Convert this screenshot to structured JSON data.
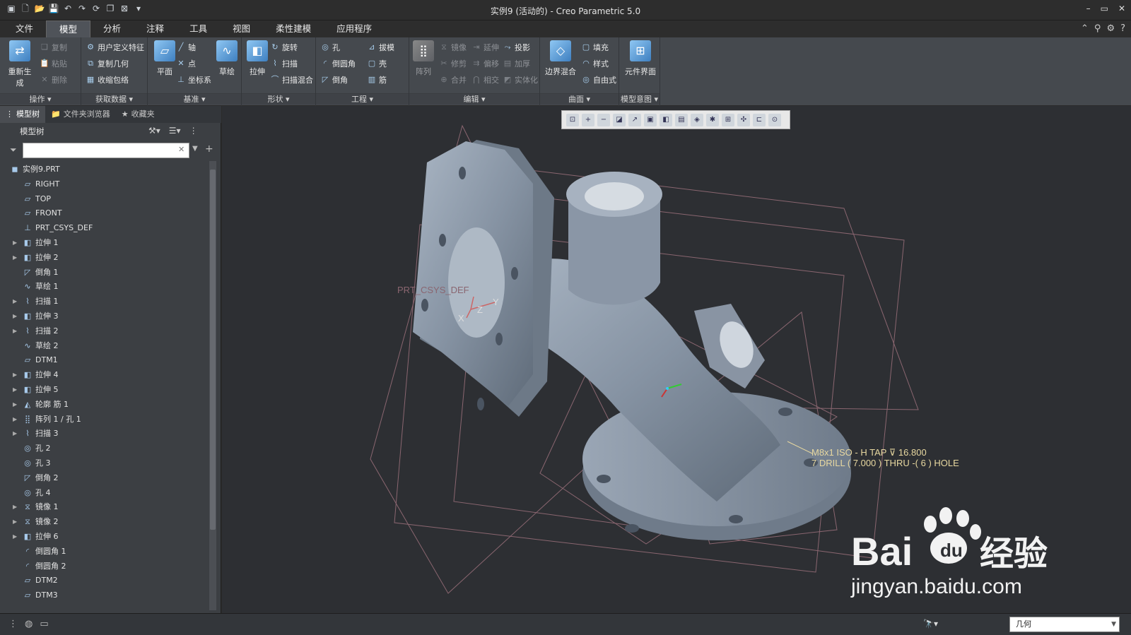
{
  "window": {
    "title": "实例9 (活动的) - Creo Parametric 5.0"
  },
  "tabs": [
    {
      "label": "文件"
    },
    {
      "label": "模型",
      "active": true
    },
    {
      "label": "分析"
    },
    {
      "label": "注释"
    },
    {
      "label": "工具"
    },
    {
      "label": "视图"
    },
    {
      "label": "柔性建模"
    },
    {
      "label": "应用程序"
    }
  ],
  "ribbon": {
    "groups": {
      "operation": "操作",
      "get_data": "获取数据",
      "datum": "基准",
      "shape": "形状",
      "engineering": "工程",
      "edit": "编辑",
      "surface": "曲面",
      "model_intent": "模型意图"
    },
    "buttons": {
      "regenerate": "重新生成",
      "copy": "复制",
      "paste": "粘贴",
      "delete": "删除",
      "udf": "用户定义特征",
      "copy_geom": "复制几何",
      "shrinkwrap": "收缩包络",
      "plane": "平面",
      "axis": "轴",
      "point": "点",
      "csys": "坐标系",
      "sketch": "草绘",
      "extrude": "拉伸",
      "revolve": "旋转",
      "sweep": "扫描",
      "swept_blend": "扫描混合",
      "hole": "孔",
      "round": "倒圆角",
      "chamfer": "倒角",
      "draft": "拔模",
      "shell": "壳",
      "rib": "筋",
      "pattern": "阵列",
      "mirror": "镜像",
      "extend": "延伸",
      "project": "投影",
      "trim": "修剪",
      "offset": "偏移",
      "thicken": "加厚",
      "merge": "合并",
      "intersect": "相交",
      "solidify": "实体化",
      "boundary_blend": "边界混合",
      "fill": "填充",
      "style": "样式",
      "freestyle": "自由式",
      "component_interface": "元件界面"
    }
  },
  "panel": {
    "tabs": [
      {
        "label": "模型树"
      },
      {
        "label": "文件夹浏览器"
      },
      {
        "label": "收藏夹"
      }
    ],
    "title": "模型树",
    "filter_placeholder": "",
    "tree": [
      {
        "label": "实例9.PRT",
        "icon": "part",
        "root": true
      },
      {
        "label": "RIGHT",
        "icon": "plane"
      },
      {
        "label": "TOP",
        "icon": "plane"
      },
      {
        "label": "FRONT",
        "icon": "plane"
      },
      {
        "label": "PRT_CSYS_DEF",
        "icon": "csys"
      },
      {
        "label": "拉伸 1",
        "icon": "extrude",
        "expand": true
      },
      {
        "label": "拉伸 2",
        "icon": "extrude",
        "expand": true
      },
      {
        "label": "倒角 1",
        "icon": "chamfer"
      },
      {
        "label": "草绘 1",
        "icon": "sketch"
      },
      {
        "label": "扫描 1",
        "icon": "sweep",
        "expand": true
      },
      {
        "label": "拉伸 3",
        "icon": "extrude",
        "expand": true
      },
      {
        "label": "扫描 2",
        "icon": "sweep",
        "expand": true
      },
      {
        "label": "草绘 2",
        "icon": "sketch"
      },
      {
        "label": "DTM1",
        "icon": "plane"
      },
      {
        "label": "拉伸 4",
        "icon": "extrude",
        "expand": true
      },
      {
        "label": "拉伸 5",
        "icon": "extrude",
        "expand": true
      },
      {
        "label": "轮廓 筋 1",
        "icon": "rib",
        "expand": true
      },
      {
        "label": "阵列 1 / 孔 1",
        "icon": "pattern",
        "expand": true
      },
      {
        "label": "扫描 3",
        "icon": "sweep",
        "expand": true
      },
      {
        "label": "孔 2",
        "icon": "hole"
      },
      {
        "label": "孔 3",
        "icon": "hole"
      },
      {
        "label": "倒角 2",
        "icon": "chamfer"
      },
      {
        "label": "孔 4",
        "icon": "hole"
      },
      {
        "label": "镜像 1",
        "icon": "mirror",
        "expand": true
      },
      {
        "label": "镜像 2",
        "icon": "mirror",
        "expand": true
      },
      {
        "label": "拉伸 6",
        "icon": "extrude",
        "expand": true
      },
      {
        "label": "倒圆角 1",
        "icon": "round"
      },
      {
        "label": "倒圆角 2",
        "icon": "round"
      },
      {
        "label": "DTM2",
        "icon": "plane"
      },
      {
        "label": "DTM3",
        "icon": "plane"
      }
    ]
  },
  "viewport": {
    "csys_label": "PRT_CSYS_DEF",
    "axis_x": "X",
    "axis_y": "Y",
    "axis_z": "Z",
    "annotation_line1": "M8x1 ISO - H TAP ⊽ 16.800",
    "annotation_line2": "7 DRILL ( 7.000 ) THRU -( 6 ) HOLE",
    "watermark_main": "Bai",
    "watermark_cn": "经验",
    "watermark_url": "jingyan.baidu.com"
  },
  "status": {
    "selection_filter": "几何"
  },
  "colors": {
    "background": "#2d2f33",
    "part": "#8a98a8",
    "datum_plane": "#8a6670",
    "annotation": "#e8d8a0"
  }
}
